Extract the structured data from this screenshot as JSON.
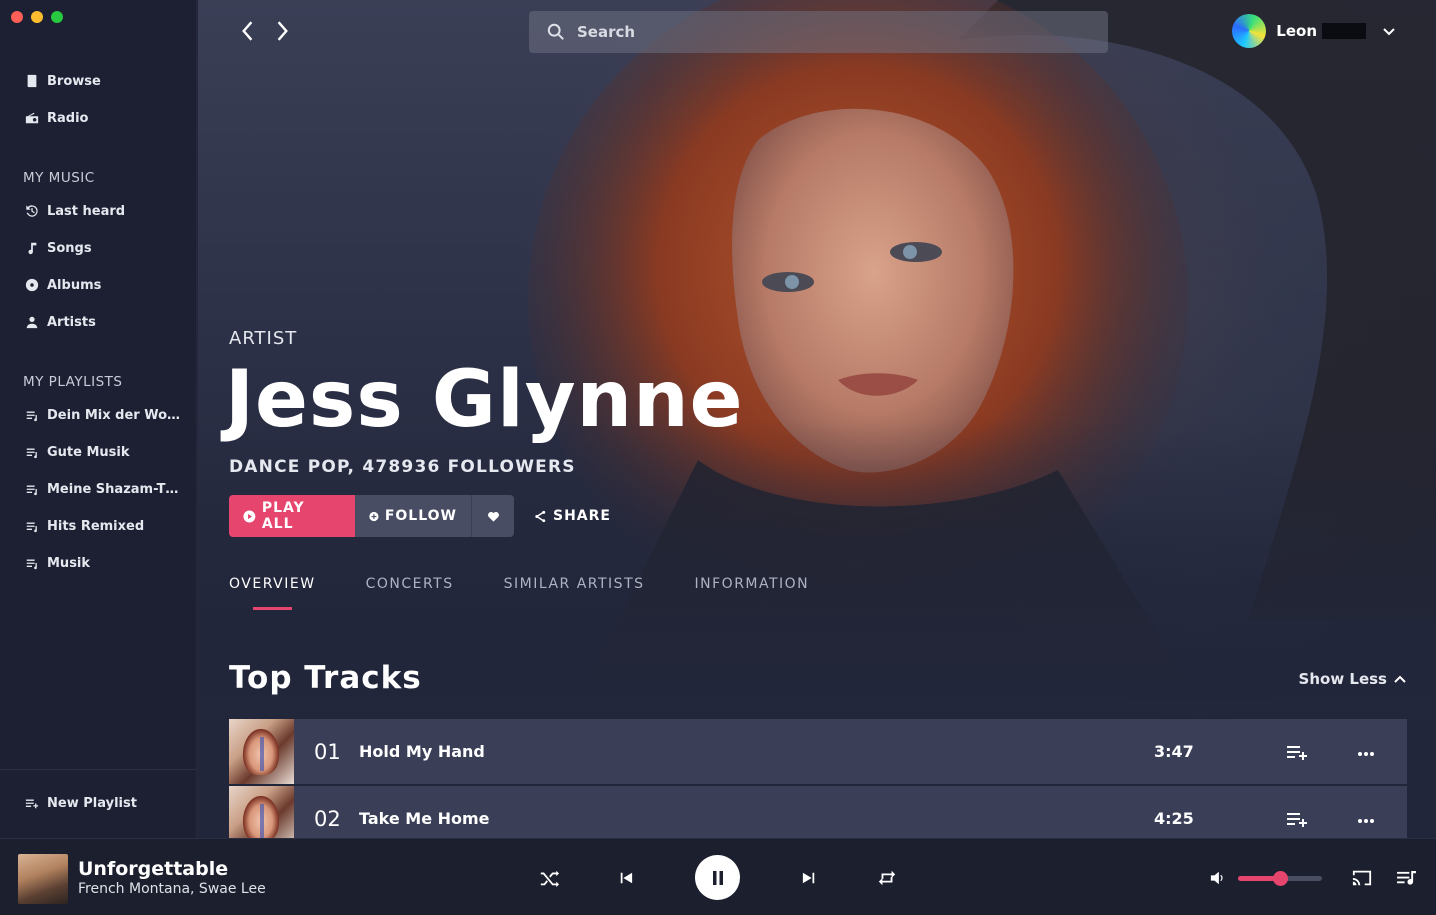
{
  "window": {
    "traffic_lights": [
      "red",
      "yellow",
      "green"
    ]
  },
  "sidebar": {
    "nav": [
      {
        "label": "Browse",
        "icon": "book-icon"
      },
      {
        "label": "Radio",
        "icon": "radio-icon"
      }
    ],
    "my_music_title": "MY MUSIC",
    "my_music": [
      {
        "label": "Last heard",
        "icon": "history-icon"
      },
      {
        "label": "Songs",
        "icon": "note-icon"
      },
      {
        "label": "Albums",
        "icon": "disc-icon"
      },
      {
        "label": "Artists",
        "icon": "person-icon"
      }
    ],
    "my_playlists_title": "MY PLAYLISTS",
    "playlists": [
      {
        "label": "Dein Mix der Wo…"
      },
      {
        "label": "Gute Musik"
      },
      {
        "label": "Meine Shazam-T…"
      },
      {
        "label": "Hits Remixed"
      },
      {
        "label": "Musik"
      }
    ],
    "new_playlist": "New Playlist"
  },
  "topbar": {
    "search_placeholder": "Search",
    "user_name": "Leon"
  },
  "artist": {
    "kicker": "ARTIST",
    "name": "Jess Glynne",
    "meta": "DANCE POP, 478936 FOLLOWERS"
  },
  "actions": {
    "play_all": "PLAY ALL",
    "follow": "FOLLOW",
    "share": "SHARE"
  },
  "tabs": [
    {
      "label": "OVERVIEW",
      "active": true
    },
    {
      "label": "CONCERTS",
      "active": false
    },
    {
      "label": "SIMILAR ARTISTS",
      "active": false
    },
    {
      "label": "INFORMATION",
      "active": false
    }
  ],
  "top_tracks": {
    "title": "Top Tracks",
    "toggle_label": "Show Less",
    "tracks": [
      {
        "number": "01",
        "title": "Hold My Hand",
        "duration": "3:47"
      },
      {
        "number": "02",
        "title": "Take Me Home",
        "duration": "4:25"
      }
    ]
  },
  "player": {
    "title": "Unforgettable",
    "artist": "French Montana, Swae Lee",
    "state": "playing",
    "volume": 0.5
  },
  "colors": {
    "accent": "#e6456d",
    "sidebar_bg": "#1c2032",
    "main_bg": "#22263a",
    "track_row": "#3a3f57",
    "player_bg": "#1c1f2d"
  }
}
